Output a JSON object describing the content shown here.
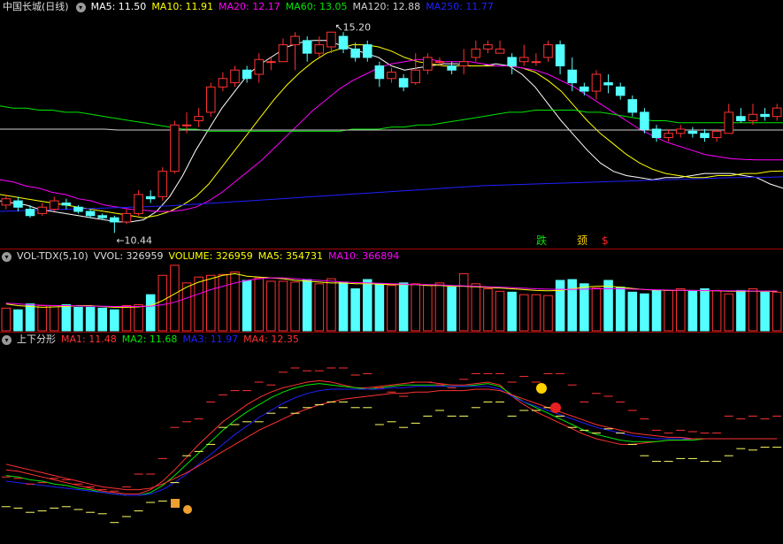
{
  "colors": {
    "up": "#ff3232",
    "down": "#54ffff",
    "ma5": "#ffffff",
    "ma10": "#ffff00",
    "ma20": "#ff00ff",
    "ma60": "#00e600",
    "ma120": "#cfcfcf",
    "ma250": "#2020ff",
    "vol_ma5": "#ffff00",
    "vol_ma10": "#ff00ff",
    "sep": "#a00000"
  },
  "price_panel": {
    "stock_name": "中国长城(日线)",
    "ma_labels": [
      {
        "text": "MA5: 11.50",
        "color": "#ffffff"
      },
      {
        "text": "MA10: 11.91",
        "color": "#ffff00"
      },
      {
        "text": "MA20: 12.17",
        "color": "#ff00ff"
      },
      {
        "text": "MA60: 13.05",
        "color": "#00e600"
      },
      {
        "text": "MA120: 12.88",
        "color": "#cfcfcf"
      },
      {
        "text": "MA250: 11.77",
        "color": "#2020ff"
      }
    ],
    "high_marker": "15.20",
    "low_marker": "10.44",
    "signal_labels": [
      {
        "text": "跌",
        "color": "#00e600"
      },
      {
        "text": "颈",
        "color": "#ffd200"
      },
      {
        "text": "$",
        "color": "#ff2020"
      }
    ]
  },
  "volume_panel": {
    "title": "VOL-TDX(5,10)",
    "labels": [
      {
        "text": "VVOL: 326959",
        "color": "#dddddd"
      },
      {
        "text": "VOLUME: 326959",
        "color": "#ffff00"
      },
      {
        "text": "MA5: 354731",
        "color": "#ffff00"
      },
      {
        "text": "MA10: 366894",
        "color": "#ff00ff"
      }
    ]
  },
  "indicator_panel": {
    "title": "上下分形",
    "labels": [
      {
        "text": "MA1: 11.48",
        "color": "#ff3232"
      },
      {
        "text": "MA2: 11.68",
        "color": "#00e600"
      },
      {
        "text": "MA3: 11.97",
        "color": "#2020ff"
      },
      {
        "text": "MA4: 12.35",
        "color": "#ff3232"
      }
    ]
  },
  "chart_data": {
    "type": "candlestick",
    "series": [
      {
        "name": "MA5",
        "values": [
          11.2,
          11.15,
          11.1,
          11.0,
          10.95,
          10.9,
          10.85,
          10.8,
          10.75,
          10.7,
          10.7,
          10.75,
          10.95,
          11.3,
          11.8,
          12.4,
          12.9,
          13.4,
          13.8,
          14.2,
          14.45,
          14.65,
          14.85,
          14.95,
          15.0,
          15.0,
          14.9,
          14.8,
          14.7,
          14.6,
          14.4,
          14.3,
          14.35,
          14.4,
          14.45,
          14.45,
          14.4,
          14.4,
          14.45,
          14.4,
          14.2,
          13.9,
          13.5,
          13.1,
          12.75,
          12.4,
          12.1,
          11.9,
          11.8,
          11.75,
          11.7,
          11.75,
          11.75,
          11.8,
          11.85,
          11.85,
          11.85,
          11.8,
          11.75,
          11.6,
          11.5
        ]
      },
      {
        "name": "MA10",
        "values": [
          11.35,
          11.3,
          11.25,
          11.2,
          11.15,
          11.1,
          11.05,
          11.0,
          10.95,
          10.9,
          10.85,
          10.8,
          10.85,
          10.95,
          11.1,
          11.3,
          11.6,
          12.0,
          12.4,
          12.8,
          13.2,
          13.6,
          13.95,
          14.25,
          14.5,
          14.7,
          14.8,
          14.9,
          14.9,
          14.85,
          14.75,
          14.6,
          14.5,
          14.45,
          14.4,
          14.4,
          14.4,
          14.4,
          14.4,
          14.4,
          14.35,
          14.25,
          14.05,
          13.8,
          13.45,
          13.1,
          12.8,
          12.55,
          12.3,
          12.1,
          11.95,
          11.85,
          11.8,
          11.75,
          11.75,
          11.8,
          11.8,
          11.85,
          11.85,
          11.9,
          11.91
        ]
      },
      {
        "name": "MA20",
        "values": [
          11.7,
          11.65,
          11.55,
          11.5,
          11.4,
          11.35,
          11.25,
          11.2,
          11.1,
          11.05,
          11.0,
          10.98,
          10.95,
          10.95,
          10.98,
          11.05,
          11.2,
          11.4,
          11.65,
          11.9,
          12.15,
          12.45,
          12.75,
          13.05,
          13.35,
          13.6,
          13.85,
          14.05,
          14.2,
          14.35,
          14.45,
          14.5,
          14.55,
          14.55,
          14.5,
          14.5,
          14.5,
          14.45,
          14.4,
          14.4,
          14.35,
          14.3,
          14.2,
          14.05,
          13.9,
          13.7,
          13.5,
          13.3,
          13.1,
          12.9,
          12.75,
          12.6,
          12.5,
          12.4,
          12.3,
          12.25,
          12.2,
          12.18,
          12.17,
          12.17,
          12.17
        ]
      },
      {
        "name": "MA60",
        "values": [
          13.45,
          13.4,
          13.4,
          13.35,
          13.35,
          13.3,
          13.3,
          13.25,
          13.2,
          13.15,
          13.1,
          13.05,
          13.0,
          12.95,
          12.9,
          12.9,
          12.85,
          12.85,
          12.85,
          12.85,
          12.85,
          12.85,
          12.85,
          12.85,
          12.85,
          12.85,
          12.85,
          12.9,
          12.9,
          12.9,
          12.95,
          12.95,
          13.0,
          13.0,
          13.05,
          13.1,
          13.15,
          13.2,
          13.25,
          13.3,
          13.3,
          13.35,
          13.35,
          13.35,
          13.35,
          13.3,
          13.3,
          13.25,
          13.2,
          13.15,
          13.1,
          13.1,
          13.05,
          13.05,
          13.05,
          13.05,
          13.05,
          13.05,
          13.05,
          13.05,
          13.05
        ]
      },
      {
        "name": "MA120",
        "values": [
          12.9,
          12.9,
          12.9,
          12.9,
          12.9,
          12.9,
          12.9,
          12.9,
          12.9,
          12.88,
          12.88,
          12.88,
          12.88,
          12.88,
          12.88,
          12.88,
          12.88,
          12.88,
          12.88,
          12.88,
          12.88,
          12.88,
          12.88,
          12.88,
          12.88,
          12.88,
          12.88,
          12.88,
          12.88,
          12.88,
          12.88,
          12.88,
          12.88,
          12.88,
          12.88,
          12.88,
          12.88,
          12.88,
          12.88,
          12.88,
          12.88,
          12.88,
          12.88,
          12.88,
          12.88,
          12.88,
          12.88,
          12.88,
          12.88,
          12.88,
          12.88,
          12.88,
          12.88,
          12.88,
          12.88,
          12.88,
          12.88,
          12.88,
          12.88,
          12.88,
          12.88
        ]
      },
      {
        "name": "MA250",
        "values": [
          10.95,
          10.96,
          10.97,
          10.98,
          10.99,
          11.0,
          11.01,
          11.02,
          11.03,
          11.04,
          11.05,
          11.06,
          11.07,
          11.08,
          11.1,
          11.12,
          11.14,
          11.16,
          11.18,
          11.2,
          11.22,
          11.24,
          11.26,
          11.28,
          11.3,
          11.32,
          11.34,
          11.36,
          11.38,
          11.4,
          11.42,
          11.44,
          11.46,
          11.48,
          11.5,
          11.52,
          11.54,
          11.56,
          11.57,
          11.58,
          11.59,
          11.6,
          11.61,
          11.62,
          11.63,
          11.64,
          11.65,
          11.66,
          11.67,
          11.68,
          11.69,
          11.7,
          11.71,
          11.72,
          11.73,
          11.74,
          11.75,
          11.75,
          11.76,
          11.76,
          11.77
        ]
      }
    ],
    "candles": [
      [
        11.1,
        11.25,
        11.35,
        11.0
      ],
      [
        11.2,
        11.05,
        11.3,
        10.95
      ],
      [
        11.0,
        10.85,
        11.1,
        10.8
      ],
      [
        10.9,
        11.05,
        11.15,
        10.85
      ],
      [
        11.0,
        11.2,
        11.3,
        10.95
      ],
      [
        11.15,
        11.1,
        11.25,
        11.0
      ],
      [
        11.05,
        10.95,
        11.1,
        10.9
      ],
      [
        10.95,
        10.85,
        11.0,
        10.8
      ],
      [
        10.85,
        10.8,
        10.9,
        10.75
      ],
      [
        10.8,
        10.7,
        10.85,
        10.44
      ],
      [
        10.7,
        10.9,
        11.0,
        10.65
      ],
      [
        10.9,
        11.35,
        11.45,
        10.85
      ],
      [
        11.3,
        11.25,
        11.45,
        11.15
      ],
      [
        11.3,
        11.9,
        12.0,
        11.2
      ],
      [
        11.9,
        13.0,
        13.1,
        11.85
      ],
      [
        13.0,
        13.0,
        13.3,
        12.8
      ],
      [
        13.1,
        13.2,
        13.4,
        12.95
      ],
      [
        13.3,
        13.9,
        14.0,
        13.2
      ],
      [
        13.9,
        14.1,
        14.25,
        13.8
      ],
      [
        14.0,
        14.3,
        14.4,
        13.9
      ],
      [
        14.3,
        14.1,
        14.4,
        14.0
      ],
      [
        14.2,
        14.55,
        14.7,
        14.0
      ],
      [
        14.5,
        14.5,
        14.6,
        14.3
      ],
      [
        14.5,
        14.9,
        15.05,
        14.5
      ],
      [
        14.9,
        15.1,
        15.2,
        14.3
      ],
      [
        15.0,
        14.7,
        15.1,
        14.5
      ],
      [
        14.7,
        14.9,
        15.1,
        14.6
      ],
      [
        14.85,
        15.2,
        15.2,
        14.7
      ],
      [
        15.1,
        14.8,
        15.2,
        14.7
      ],
      [
        14.8,
        14.6,
        14.95,
        14.5
      ],
      [
        14.9,
        14.6,
        15.0,
        14.5
      ],
      [
        14.4,
        14.1,
        14.5,
        13.9
      ],
      [
        14.1,
        14.25,
        14.35,
        14.0
      ],
      [
        14.1,
        13.9,
        14.2,
        13.8
      ],
      [
        14.0,
        14.3,
        14.7,
        13.95
      ],
      [
        14.3,
        14.6,
        14.7,
        14.2
      ],
      [
        14.5,
        14.5,
        14.6,
        14.4
      ],
      [
        14.4,
        14.3,
        14.5,
        14.2
      ],
      [
        14.4,
        14.5,
        14.8,
        14.2
      ],
      [
        14.6,
        14.8,
        15.0,
        14.5
      ],
      [
        14.8,
        14.9,
        15.0,
        14.7
      ],
      [
        14.7,
        14.8,
        15.0,
        14.7
      ],
      [
        14.6,
        14.4,
        14.7,
        14.2
      ],
      [
        14.5,
        14.6,
        14.9,
        14.4
      ],
      [
        14.5,
        14.5,
        14.7,
        14.4
      ],
      [
        14.6,
        14.9,
        15.0,
        14.5
      ],
      [
        14.9,
        14.4,
        15.0,
        14.2
      ],
      [
        14.3,
        14.0,
        14.6,
        13.8
      ],
      [
        13.9,
        13.8,
        14.0,
        13.7
      ],
      [
        13.8,
        14.2,
        14.3,
        13.6
      ],
      [
        14.0,
        13.95,
        14.2,
        13.75
      ],
      [
        13.9,
        13.7,
        14.0,
        13.6
      ],
      [
        13.6,
        13.3,
        13.7,
        13.2
      ],
      [
        13.3,
        12.9,
        13.4,
        12.8
      ],
      [
        12.9,
        12.7,
        13.0,
        12.6
      ],
      [
        12.7,
        12.8,
        12.9,
        12.6
      ],
      [
        12.8,
        12.9,
        13.0,
        12.7
      ],
      [
        12.85,
        12.8,
        12.95,
        12.7
      ],
      [
        12.8,
        12.7,
        12.9,
        12.6
      ],
      [
        12.7,
        12.85,
        12.9,
        12.6
      ],
      [
        12.8,
        13.3,
        13.5,
        12.8
      ],
      [
        13.2,
        13.1,
        13.4,
        13.05
      ],
      [
        13.1,
        13.25,
        13.5,
        13.0
      ],
      [
        13.25,
        13.2,
        13.4,
        13.1
      ],
      [
        13.2,
        13.4,
        13.5,
        13.1
      ]
    ],
    "volume": [
      135,
      125,
      160,
      150,
      150,
      155,
      140,
      140,
      135,
      125,
      150,
      155,
      215,
      330,
      390,
      285,
      320,
      330,
      335,
      350,
      300,
      315,
      295,
      295,
      290,
      305,
      280,
      310,
      290,
      250,
      305,
      280,
      270,
      285,
      280,
      270,
      285,
      260,
      340,
      280,
      250,
      235,
      230,
      215,
      215,
      210,
      300,
      305,
      280,
      255,
      300,
      260,
      230,
      220,
      240,
      240,
      250,
      235,
      250,
      240,
      220,
      240,
      250,
      230,
      230
    ],
    "volume_ma5": [
      160,
      150,
      145,
      140,
      142,
      145,
      150,
      150,
      145,
      140,
      140,
      142,
      150,
      180,
      220,
      260,
      290,
      310,
      330,
      340,
      325,
      320,
      315,
      310,
      300,
      295,
      290,
      285,
      285,
      280,
      280,
      278,
      275,
      275,
      275,
      270,
      270,
      265,
      265,
      262,
      258,
      255,
      250,
      245,
      240,
      238,
      240,
      250,
      260,
      265,
      265,
      260,
      252,
      245,
      242,
      240,
      240,
      240,
      238,
      238,
      236,
      236,
      236,
      235,
      235
    ],
    "volume_ma10": [
      165,
      160,
      155,
      152,
      150,
      150,
      148,
      147,
      146,
      145,
      145,
      145,
      147,
      155,
      170,
      195,
      220,
      245,
      265,
      285,
      300,
      310,
      315,
      315,
      310,
      305,
      300,
      295,
      290,
      287,
      285,
      283,
      280,
      278,
      276,
      275,
      273,
      270,
      268,
      265,
      262,
      260,
      257,
      253,
      250,
      248,
      247,
      247,
      248,
      250,
      250,
      250,
      248,
      246,
      244,
      242,
      241,
      240,
      240,
      239,
      238,
      238,
      237,
      237,
      237
    ],
    "indicator": {
      "MA1": [
        12.0,
        11.95,
        11.85,
        11.75,
        11.65,
        11.55,
        11.45,
        11.35,
        11.25,
        11.2,
        11.15,
        11.15,
        11.3,
        11.6,
        12.0,
        12.45,
        12.9,
        13.3,
        13.7,
        14.0,
        14.3,
        14.55,
        14.75,
        14.9,
        15.0,
        15.1,
        15.15,
        15.1,
        15.0,
        14.9,
        14.9,
        14.95,
        15.0,
        15.05,
        15.1,
        15.1,
        15.05,
        15.0,
        15.0,
        15.05,
        15.1,
        15.0,
        14.6,
        14.3,
        14.05,
        13.85,
        13.65,
        13.45,
        13.25,
        13.1,
        13.0,
        12.9,
        12.9,
        12.95,
        13.0,
        13.05,
        13.05,
        13.1,
        13.1,
        13.1,
        13.1,
        13.1,
        13.1,
        13.1,
        13.1
      ],
      "MA2": [
        11.8,
        11.75,
        11.65,
        11.6,
        11.5,
        11.45,
        11.35,
        11.3,
        11.2,
        11.15,
        11.1,
        11.1,
        11.2,
        11.45,
        11.8,
        12.2,
        12.6,
        13.0,
        13.4,
        13.75,
        14.05,
        14.3,
        14.55,
        14.75,
        14.9,
        15.0,
        15.05,
        15.0,
        14.95,
        14.9,
        14.85,
        14.9,
        14.95,
        15.0,
        15.0,
        15.0,
        15.0,
        14.95,
        14.95,
        15.0,
        15.05,
        14.95,
        14.65,
        14.4,
        14.2,
        14.0,
        13.8,
        13.6,
        13.4,
        13.25,
        13.15,
        13.05,
        13.0,
        13.0,
        13.0,
        13.05,
        13.05,
        13.05,
        13.1,
        13.1,
        13.1,
        13.1,
        13.1,
        13.1,
        13.1
      ],
      "MA3": [
        11.6,
        11.55,
        11.5,
        11.45,
        11.4,
        11.35,
        11.3,
        11.25,
        11.2,
        11.15,
        11.1,
        11.1,
        11.15,
        11.3,
        11.55,
        11.85,
        12.2,
        12.55,
        12.9,
        13.25,
        13.55,
        13.85,
        14.1,
        14.35,
        14.55,
        14.7,
        14.8,
        14.85,
        14.85,
        14.85,
        14.85,
        14.85,
        14.9,
        14.9,
        14.95,
        14.95,
        14.95,
        14.95,
        14.95,
        14.95,
        14.95,
        14.85,
        14.6,
        14.4,
        14.25,
        14.1,
        13.95,
        13.8,
        13.65,
        13.5,
        13.4,
        13.3,
        13.2,
        13.15,
        13.1,
        13.1,
        13.1,
        13.1,
        13.1,
        13.1,
        13.1,
        13.1,
        13.1,
        13.1,
        13.1
      ],
      "MA4": [
        12.2,
        12.1,
        12.0,
        11.9,
        11.8,
        11.7,
        11.6,
        11.5,
        11.4,
        11.35,
        11.3,
        11.3,
        11.35,
        11.5,
        11.7,
        11.9,
        12.15,
        12.4,
        12.65,
        12.9,
        13.15,
        13.4,
        13.6,
        13.8,
        14.0,
        14.15,
        14.3,
        14.4,
        14.5,
        14.55,
        14.6,
        14.65,
        14.7,
        14.7,
        14.75,
        14.75,
        14.8,
        14.8,
        14.8,
        14.85,
        14.85,
        14.8,
        14.65,
        14.5,
        14.35,
        14.2,
        14.05,
        13.9,
        13.75,
        13.6,
        13.5,
        13.4,
        13.3,
        13.25,
        13.2,
        13.15,
        13.15,
        13.1,
        13.1,
        13.1,
        13.1,
        13.1,
        13.1,
        13.1,
        13.1
      ]
    }
  }
}
